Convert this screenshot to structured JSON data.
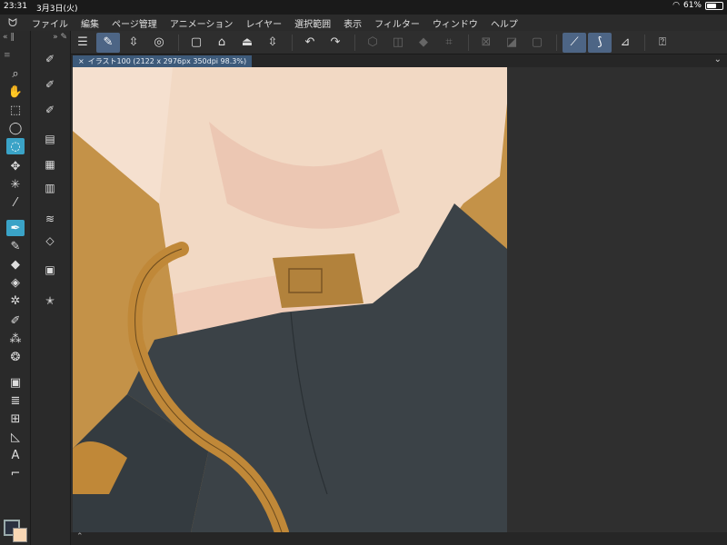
{
  "status": {
    "time": "23:31",
    "date": "3月3日(火)",
    "battery_percent": "61%",
    "battery_level": 0.61
  },
  "menu": {
    "logo_icon": "clip-studio-logo-icon",
    "items": [
      "ファイル",
      "編集",
      "ページ管理",
      "アニメーション",
      "レイヤー",
      "選択範囲",
      "表示",
      "フィルター",
      "ウィンドウ",
      "ヘルプ"
    ]
  },
  "document_tab": {
    "label": "イラスト100 (2122 x 2976px 350dpi 98.3%)"
  },
  "colors": {
    "accent_tool": "#3aa3c7",
    "active_toolbar": "#4d6585",
    "main_color": "#2a3140",
    "sub_color": "#f8d7b5",
    "canvas_background": "#c49248",
    "shirt": "#f2d9c4",
    "pants": "#3b4247"
  },
  "left_tools": [
    "zoom-icon",
    "hand-icon",
    "operation-icon",
    "lasso-icon",
    "lasso-fill-icon",
    "move-icon",
    "auto-select-icon",
    "eyedropper-icon",
    "pen-icon",
    "pencil-icon",
    "eraser-icon",
    "fill-icon",
    "decoration-icon",
    "brush-icon",
    "airbrush-icon",
    "blend-icon",
    "gradient-icon",
    "figure-icon",
    "frame-icon",
    "ruler-icon",
    "text-icon",
    "correction-icon"
  ],
  "sub_tools": [
    "subtool-pen-a-icon",
    "subtool-pen-b-icon",
    "subtool-pen-c-icon",
    "subtool-layer-icon",
    "subtool-grid-icon",
    "subtool-film-icon",
    "subtool-stack-icon",
    "subtool-layers-icon",
    "subtool-folder-icon",
    "subtool-star-icon"
  ],
  "toolbar": [
    "menu-icon",
    "edit-pen-icon",
    "stepper-icon",
    "spiral-icon",
    "new-doc-icon",
    "open-icon",
    "save-icon",
    "stepper-icon-2",
    "undo-icon",
    "redo-icon",
    "select-clear-icon",
    "select-invert-icon",
    "fill-selection-icon",
    "crop-icon",
    "hide-selection-icon",
    "mask-icon",
    "frame-border-icon",
    "snap-ruler-icon",
    "snap-special-icon",
    "snap-grid-icon",
    "help-icon"
  ]
}
